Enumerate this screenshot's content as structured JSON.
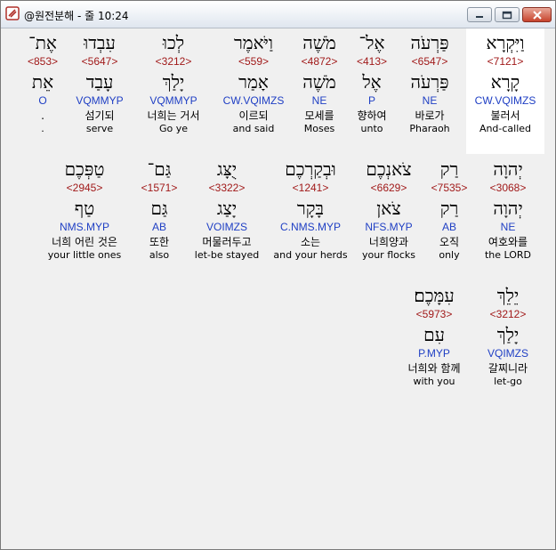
{
  "window": {
    "title": "@원전분해 - 줄 10:24",
    "buttons": {
      "minimize": "minimize",
      "maximize": "maximize",
      "close": "close"
    }
  },
  "icons": {
    "app": "app-icon",
    "minimize": "minimize-icon",
    "maximize": "maximize-icon",
    "close": "close-icon"
  },
  "rows": [
    {
      "words": [
        {
          "heb": "וַיִּקְרָא",
          "strong": "<7121>",
          "lemma": "קָרָא",
          "morph": "CW.VQIMZS",
          "kor": "불러서",
          "eng": "And-called",
          "highlighted": true
        },
        {
          "heb": "פַּרְעֹה",
          "strong": "<6547>",
          "lemma": "פַּרְעֹה",
          "morph": "NE",
          "kor": "바로가",
          "eng": "Pharaoh"
        },
        {
          "heb": "אֶל־",
          "strong": "<413>",
          "lemma": "אֶל",
          "morph": "P",
          "kor": "향하여",
          "eng": "unto"
        },
        {
          "heb": "מֹשֶׁה",
          "strong": "<4872>",
          "lemma": "מֹשֶׁה",
          "morph": "NE",
          "kor": "모세를",
          "eng": "Moses"
        },
        {
          "heb": "וַיֹּאמֶר",
          "strong": "<559>",
          "lemma": "אָמַר",
          "morph": "CW.VQIMZS",
          "kor": "이르되",
          "eng": "and said"
        },
        {
          "heb": "לְכוּ",
          "strong": "<3212>",
          "lemma": "יָלַךְ",
          "morph": "VQMMYP",
          "kor": "너희는 거서",
          "eng": "Go ye"
        },
        {
          "heb": "עִבְדוּ",
          "strong": "<5647>",
          "lemma": "עָבַד",
          "morph": "VQMMYP",
          "kor": "섬기되",
          "eng": "serve"
        },
        {
          "heb": "אֶת־",
          "strong": "<853>",
          "lemma": "אֵת",
          "morph": "O",
          "kor": ".",
          "eng": "."
        }
      ]
    },
    {
      "words": [
        {
          "heb": "יְהוָה",
          "strong": "<3068>",
          "lemma": "יְהוָה",
          "morph": "NE",
          "kor": "여호와를",
          "eng": "the LORD"
        },
        {
          "heb": "רַק",
          "strong": "<7535>",
          "lemma": "רַק",
          "morph": "AB",
          "kor": "오직",
          "eng": "only"
        },
        {
          "heb": "צֹאנְכֶם",
          "strong": "<6629>",
          "lemma": "צֹאן",
          "morph": "NFS.MYP",
          "kor": "너희양과",
          "eng": "your flocks"
        },
        {
          "heb": "וּבְקַרְכֶם",
          "strong": "<1241>",
          "lemma": "בָּקָר",
          "morph": "C.NMS.MYP",
          "kor": "소는",
          "eng": "and your herds"
        },
        {
          "heb": "יֻצָּג",
          "strong": "<3322>",
          "lemma": "יָצַג",
          "morph": "VOIMZS",
          "kor": "머물러두고",
          "eng": "let-be stayed"
        },
        {
          "heb": "גַּם־",
          "strong": "<1571>",
          "lemma": "גַּם",
          "morph": "AB",
          "kor": "또한",
          "eng": "also"
        },
        {
          "heb": "טַפְּכֶם",
          "strong": "<2945>",
          "lemma": "טַף",
          "morph": "NMS.MYP",
          "kor": "너희 어린 것은",
          "eng": "your little ones"
        }
      ]
    },
    {
      "words": [
        {
          "heb": "יֵלֵךְ",
          "strong": "<3212>",
          "lemma": "יָלַךְ",
          "morph": "VQIMZS",
          "kor": "갈찌니라",
          "eng": "let-go"
        },
        {
          "heb": "עִמָּכֶם׃",
          "strong": "<5973>",
          "lemma": "עִם",
          "morph": "P.MYP",
          "kor": "너희와 함께",
          "eng": "with you"
        }
      ]
    }
  ]
}
